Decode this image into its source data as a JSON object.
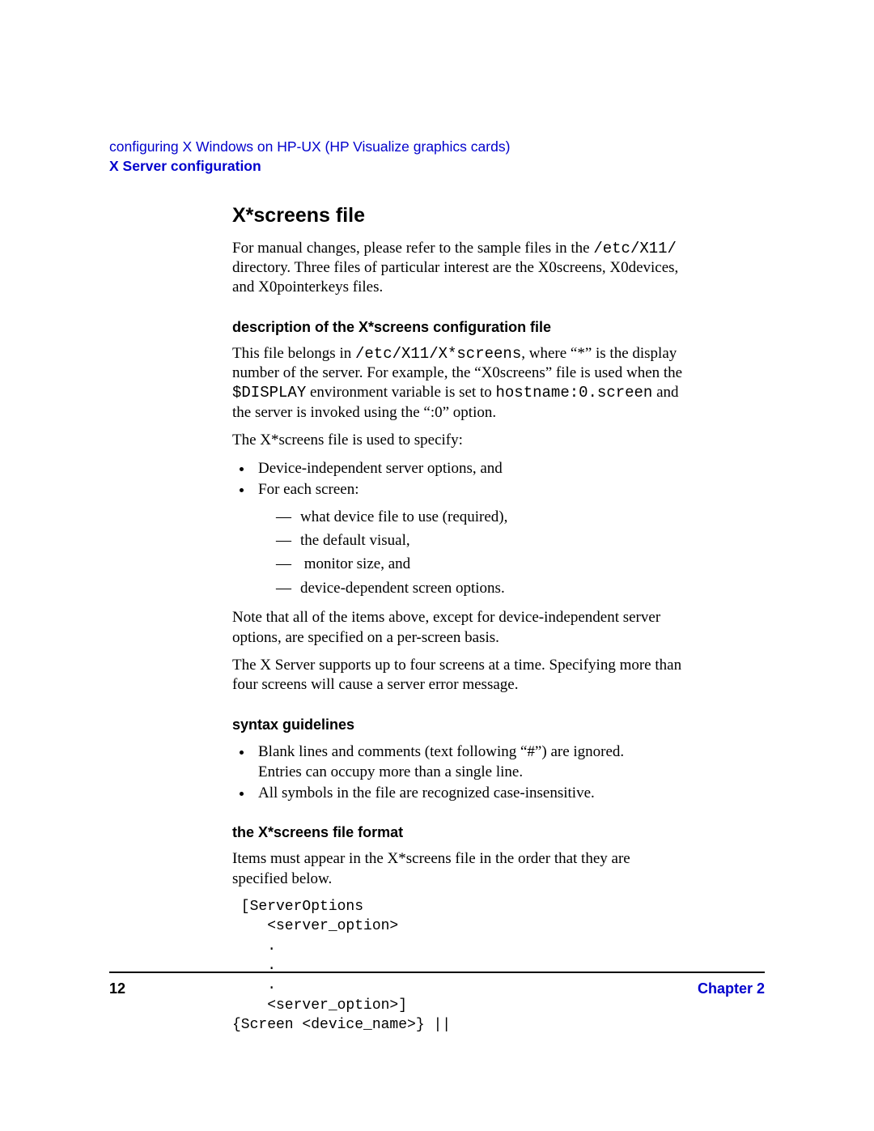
{
  "header": {
    "breadcrumb": "configuring X Windows on HP-UX (HP Visualize graphics cards)",
    "section": "X Server configuration"
  },
  "title": "X*screens file",
  "intro": {
    "pre": "For manual changes, please refer to the sample files in the ",
    "code": "/etc/X11/",
    "post": " directory. Three files of particular interest are the X0screens, X0devices, and X0pointerkeys files."
  },
  "desc": {
    "heading": "description of the X*screens configuration file",
    "p1": {
      "a": "This file belongs in ",
      "code1": "/etc/X11/X*screens",
      "b": ", where “*” is the display number of the server. For example, the “X0screens” file is used when the ",
      "code2": "$DISPLAY",
      "c": " environment variable is set to ",
      "code3": " hostname:0.screen",
      "d": " and the server is invoked using the “:0” option."
    },
    "p2": "The X*screens file is used to specify:",
    "bullets": [
      "Device-independent server options, and",
      "For each screen:"
    ],
    "dashes": [
      "what device file to use (required),",
      "the default visual,",
      " monitor size, and",
      "device-dependent screen options."
    ],
    "p3": "Note that all of the items above, except for device-independent server options, are specified on a per-screen basis.",
    "p4": "The X Server supports up to four screens at a time. Specifying more than four screens will cause a server error message."
  },
  "syntax": {
    "heading": "syntax guidelines",
    "bullets": [
      "Blank lines and comments (text following “#”) are ignored.\nEntries can occupy more than a single line.",
      "All symbols in the file are recognized case-insensitive."
    ]
  },
  "format": {
    "heading": "the X*screens file format",
    "p1": "Items must appear in the X*screens file in the order that they are specified below.",
    "code": " [ServerOptions\n    <server_option>\n    .\n    .\n    .\n    <server_option>]\n{Screen <device_name>} ||"
  },
  "footer": {
    "page": "12",
    "chapter": "Chapter 2"
  }
}
